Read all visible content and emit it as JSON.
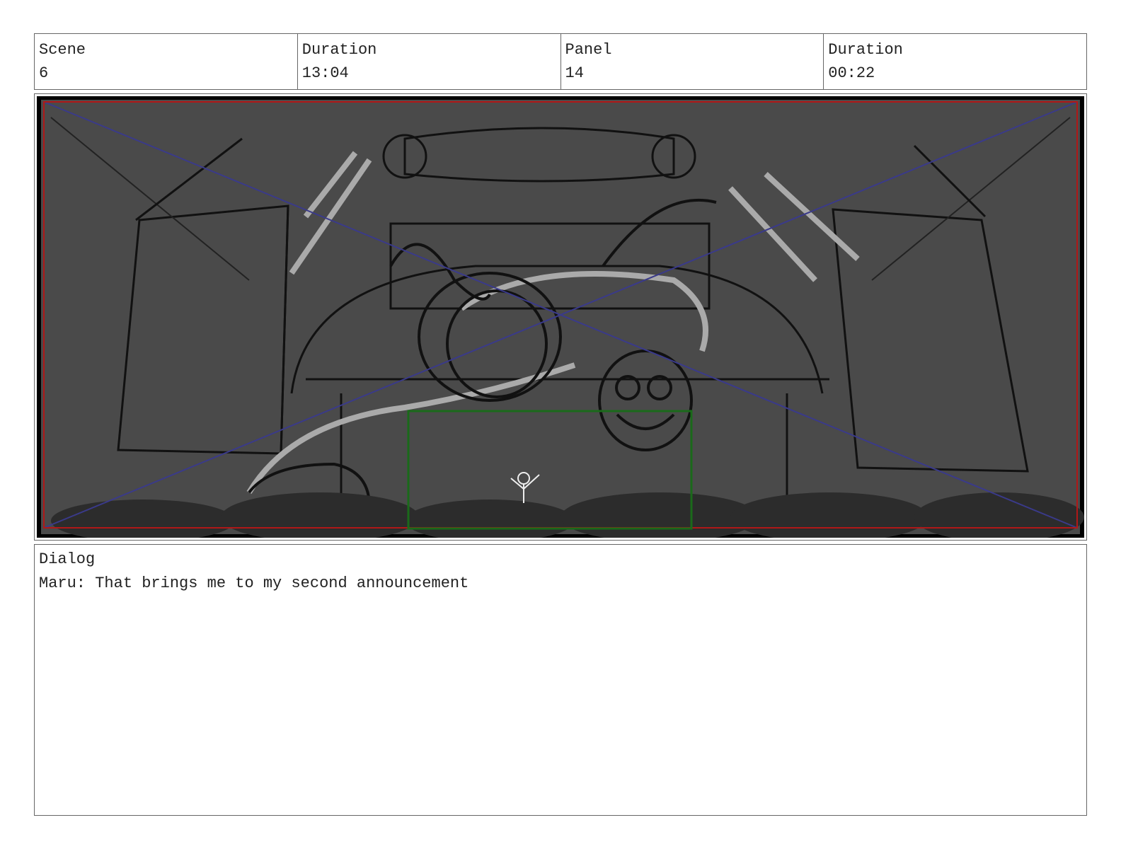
{
  "header": {
    "scene_label": "Scene",
    "scene_value": "6",
    "scene_duration_label": "Duration",
    "scene_duration_value": "13:04",
    "panel_label": "Panel",
    "panel_value": "14",
    "panel_duration_label": "Duration",
    "panel_duration_value": "00:22"
  },
  "panel_image": {
    "description_icon": "storyboard-sketch",
    "colors": {
      "background": "#4a4a4a",
      "safe_frame": "#b01818",
      "camera_box": "#1a6a1a",
      "guide_lines": "#3a3a8a"
    }
  },
  "dialog": {
    "label": "Dialog",
    "text": "Maru: That brings me to my second announcement"
  }
}
